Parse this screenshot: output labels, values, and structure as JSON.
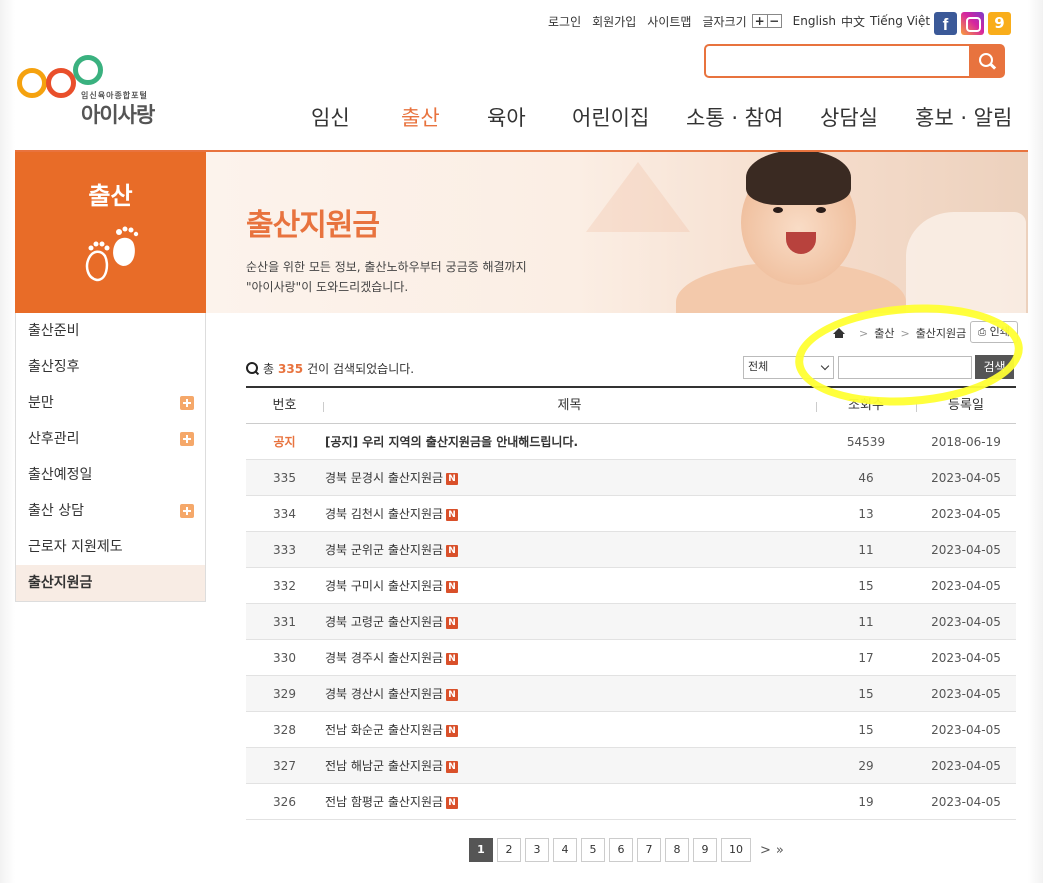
{
  "utility": {
    "login": "로그인",
    "join": "회원가입",
    "sitemap": "사이트맵",
    "fontsize_label": "글자크기",
    "plus": "+",
    "minus": "−",
    "lang_en": "English",
    "lang_zh": "中文",
    "lang_vi": "Tiếng Việt"
  },
  "sns": {
    "facebook": "f",
    "kakao": "9"
  },
  "logo": {
    "tagline": "임신육아종합포털",
    "name": "아이사랑"
  },
  "search": {
    "placeholder": ""
  },
  "gnb": [
    "임신",
    "출산",
    "육아",
    "어린이집",
    "소통 · 참여",
    "상담실",
    "홍보 · 알림"
  ],
  "gnb_active": "출산",
  "side_title": "출산",
  "banner": {
    "title": "출산지원금",
    "desc_line1": "순산을 위한 모든 정보, 출산노하우부터 궁금증 해결까지",
    "desc_line2": "\"아이사랑\"이 도와드리겠습니다."
  },
  "lnb": [
    {
      "label": "출산준비",
      "plus": false
    },
    {
      "label": "출산징후",
      "plus": false
    },
    {
      "label": "분만",
      "plus": true
    },
    {
      "label": "산후관리",
      "plus": true
    },
    {
      "label": "출산예정일",
      "plus": false
    },
    {
      "label": "출산 상담",
      "plus": true
    },
    {
      "label": "근로자 지원제도",
      "plus": false
    },
    {
      "label": "출산지원금",
      "plus": false,
      "active": true
    }
  ],
  "breadcrumb": {
    "sep": ">",
    "level1": "출산",
    "level2": "출산지원금"
  },
  "print_label": "인쇄",
  "count": {
    "prefix": "총",
    "number": "335",
    "suffix": "건이 검색되었습니다."
  },
  "search_filter": {
    "selected": "전체",
    "button": "검색"
  },
  "table": {
    "headers": [
      "번호",
      "제목",
      "조회수",
      "등록일"
    ],
    "new_badge": "N",
    "rows": [
      {
        "no": "공지",
        "title": "[공지] 우리 지역의 출산지원금을 안내해드립니다.",
        "views": "54539",
        "date": "2018-06-19",
        "notice": true
      },
      {
        "no": "335",
        "title": "경북 문경시 출산지원금",
        "views": "46",
        "date": "2023-04-05"
      },
      {
        "no": "334",
        "title": "경북 김천시 출산지원금",
        "views": "13",
        "date": "2023-04-05"
      },
      {
        "no": "333",
        "title": "경북 군위군 출산지원금",
        "views": "11",
        "date": "2023-04-05"
      },
      {
        "no": "332",
        "title": "경북 구미시 출산지원금",
        "views": "15",
        "date": "2023-04-05"
      },
      {
        "no": "331",
        "title": "경북 고령군 출산지원금",
        "views": "11",
        "date": "2023-04-05"
      },
      {
        "no": "330",
        "title": "경북 경주시 출산지원금",
        "views": "17",
        "date": "2023-04-05"
      },
      {
        "no": "329",
        "title": "경북 경산시 출산지원금",
        "views": "15",
        "date": "2023-04-05"
      },
      {
        "no": "328",
        "title": "전남 화순군 출산지원금",
        "views": "15",
        "date": "2023-04-05"
      },
      {
        "no": "327",
        "title": "전남 해남군 출산지원금",
        "views": "29",
        "date": "2023-04-05"
      },
      {
        "no": "326",
        "title": "전남 함평군 출산지원금",
        "views": "19",
        "date": "2023-04-05"
      }
    ]
  },
  "paging": {
    "pages": [
      "1",
      "2",
      "3",
      "4",
      "5",
      "6",
      "7",
      "8",
      "9",
      "10"
    ],
    "current": "1",
    "next": ">",
    "last": "»"
  },
  "colors": {
    "accent": "#e8733e",
    "side": "#e86c28",
    "highlight": "#ffff33"
  }
}
